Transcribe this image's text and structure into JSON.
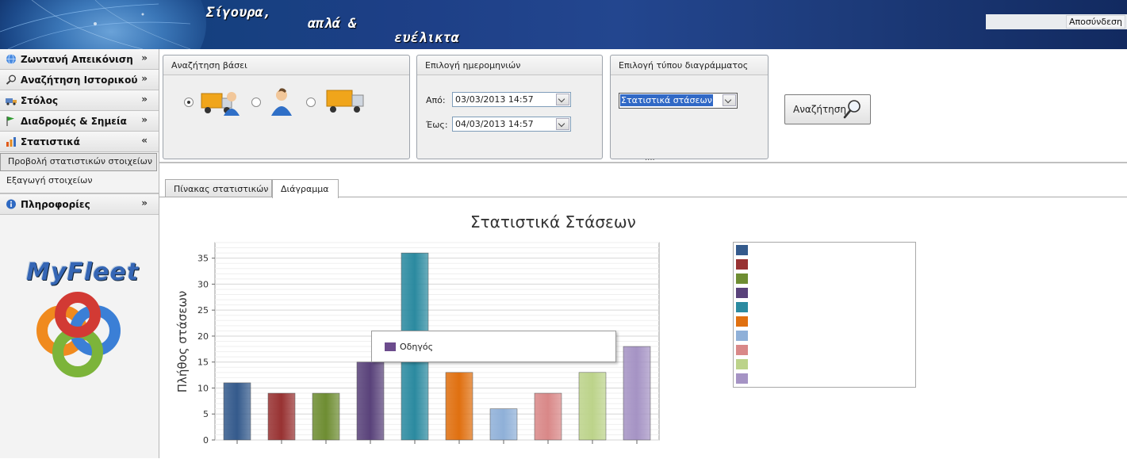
{
  "header": {
    "slogan_1": "Σίγουρα,",
    "slogan_2": "απλά  &",
    "slogan_3": "ευέλικτα",
    "logout_label": "Αποσύνδεση"
  },
  "sidebar": {
    "items": [
      {
        "label": "Ζωντανή Απεικόνιση",
        "icon": "globe-icon",
        "chevron": "»"
      },
      {
        "label": "Αναζήτηση Ιστορικού",
        "icon": "magnifier-icon",
        "chevron": "»"
      },
      {
        "label": "Στόλος",
        "icon": "vehicles-icon",
        "chevron": "»"
      },
      {
        "label": "Διαδρομές & Σημεία",
        "icon": "flag-icon",
        "chevron": "»"
      },
      {
        "label": "Στατιστικά",
        "icon": "bar-chart-icon",
        "chevron": "«"
      },
      {
        "label": "Πληροφορίες",
        "icon": "info-icon",
        "chevron": "»"
      }
    ],
    "stats_sub": [
      "Προβολή στατιστικών στοιχείων",
      "Εξαγωγή στοιχείων"
    ],
    "brand": "MyFleet"
  },
  "search_panel": {
    "title": "Αναζήτηση βάσει",
    "options": [
      {
        "icon": "truck-with-driver-icon",
        "selected": true
      },
      {
        "icon": "driver-icon",
        "selected": false
      },
      {
        "icon": "truck-icon",
        "selected": false
      }
    ]
  },
  "date_panel": {
    "title": "Επιλογή ημερομηνιών",
    "from_label": "Από:",
    "from_value": "03/03/2013 14:57",
    "to_label": "Έως:",
    "to_value": "04/03/2013 14:57"
  },
  "chart_type_panel": {
    "title": "Επιλογή τύπου διαγράμματος",
    "selected": "Στατιστικά στάσεων"
  },
  "search_button": {
    "label": "Αναζήτηση"
  },
  "tabs": [
    {
      "label": "Πίνακας στατιστικών",
      "active": false
    },
    {
      "label": "Διάγραμμα",
      "active": true
    }
  ],
  "tooltip": {
    "label": "Οδηγός",
    "color": "#6c4c8d"
  },
  "chart_data": {
    "type": "bar",
    "title": "Στατιστικά Στάσεων",
    "xlabel": "",
    "ylabel": "Πλήθος στάσεων",
    "ylim": [
      0,
      38
    ],
    "yticks": [
      0,
      5,
      10,
      15,
      20,
      25,
      30,
      35
    ],
    "values": [
      11,
      9,
      9,
      15,
      36,
      13,
      6,
      9,
      13,
      18
    ],
    "colors": [
      "#345a8c",
      "#983232",
      "#6e8d32",
      "#59427a",
      "#2b8aa0",
      "#e07010",
      "#8fb0d8",
      "#d98888",
      "#bcd38a",
      "#a593c4"
    ],
    "grid": true,
    "legend": "right"
  }
}
